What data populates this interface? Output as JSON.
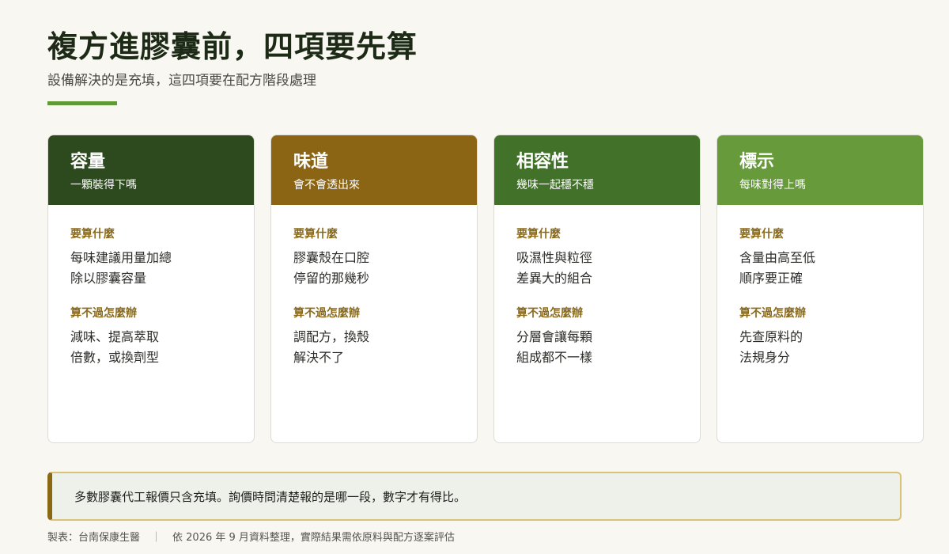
{
  "header": {
    "title": "複方進膠囊前，四項要先算",
    "subtitle": "設備解決的是充填，這四項要在配方階段處理"
  },
  "colors": {
    "accent_bar": "#5f9a37",
    "label_gold": "#8a6a1a",
    "note_border": "#8b6914"
  },
  "cards": [
    {
      "title": "容量",
      "subtitle": "一顆裝得下嗎",
      "header_color": "#2d4a1f",
      "calc_label": "要算什麼",
      "calc_line1": "每味建議用量加總",
      "calc_line2": "除以膠囊容量",
      "fail_label": "算不過怎麼辦",
      "fail_line1": "減味、提高萃取",
      "fail_line2": "倍數，或換劑型"
    },
    {
      "title": "味道",
      "subtitle": "會不會透出來",
      "header_color": "#8b6414",
      "calc_label": "要算什麼",
      "calc_line1": "膠囊殼在口腔",
      "calc_line2": "停留的那幾秒",
      "fail_label": "算不過怎麼辦",
      "fail_line1": "調配方，換殼",
      "fail_line2": "解決不了"
    },
    {
      "title": "相容性",
      "subtitle": "幾味一起穩不穩",
      "header_color": "#42712a",
      "calc_label": "要算什麼",
      "calc_line1": "吸濕性與粒徑",
      "calc_line2": "差異大的組合",
      "fail_label": "算不過怎麼辦",
      "fail_line1": "分層會讓每顆",
      "fail_line2": "組成都不一樣"
    },
    {
      "title": "標示",
      "subtitle": "每味對得上嗎",
      "header_color": "#669a3a",
      "calc_label": "要算什麼",
      "calc_line1": "含量由高至低",
      "calc_line2": "順序要正確",
      "fail_label": "算不過怎麼辦",
      "fail_line1": "先查原料的",
      "fail_line2": "法規身分"
    }
  ],
  "note": {
    "text": "多數膠囊代工報價只含充填。詢價時問清楚報的是哪一段，數字才有得比。"
  },
  "footer": {
    "credit": "製表：台南保康生醫",
    "separator": "｜",
    "source": "依 2026 年 9 月資料整理，實際結果需依原料與配方逐案評估"
  }
}
